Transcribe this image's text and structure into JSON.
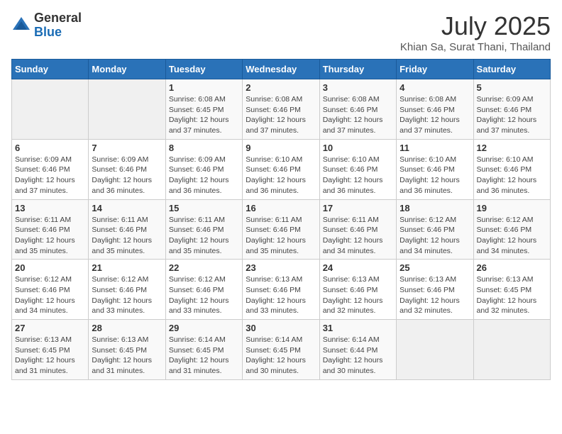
{
  "header": {
    "logo": {
      "general": "General",
      "blue": "Blue"
    },
    "title": "July 2025",
    "location": "Khian Sa, Surat Thani, Thailand"
  },
  "days_of_week": [
    "Sunday",
    "Monday",
    "Tuesday",
    "Wednesday",
    "Thursday",
    "Friday",
    "Saturday"
  ],
  "weeks": [
    [
      {
        "day": "",
        "empty": true
      },
      {
        "day": "",
        "empty": true
      },
      {
        "day": "1",
        "sunrise": "Sunrise: 6:08 AM",
        "sunset": "Sunset: 6:45 PM",
        "daylight": "Daylight: 12 hours and 37 minutes."
      },
      {
        "day": "2",
        "sunrise": "Sunrise: 6:08 AM",
        "sunset": "Sunset: 6:46 PM",
        "daylight": "Daylight: 12 hours and 37 minutes."
      },
      {
        "day": "3",
        "sunrise": "Sunrise: 6:08 AM",
        "sunset": "Sunset: 6:46 PM",
        "daylight": "Daylight: 12 hours and 37 minutes."
      },
      {
        "day": "4",
        "sunrise": "Sunrise: 6:08 AM",
        "sunset": "Sunset: 6:46 PM",
        "daylight": "Daylight: 12 hours and 37 minutes."
      },
      {
        "day": "5",
        "sunrise": "Sunrise: 6:09 AM",
        "sunset": "Sunset: 6:46 PM",
        "daylight": "Daylight: 12 hours and 37 minutes."
      }
    ],
    [
      {
        "day": "6",
        "sunrise": "Sunrise: 6:09 AM",
        "sunset": "Sunset: 6:46 PM",
        "daylight": "Daylight: 12 hours and 37 minutes."
      },
      {
        "day": "7",
        "sunrise": "Sunrise: 6:09 AM",
        "sunset": "Sunset: 6:46 PM",
        "daylight": "Daylight: 12 hours and 36 minutes."
      },
      {
        "day": "8",
        "sunrise": "Sunrise: 6:09 AM",
        "sunset": "Sunset: 6:46 PM",
        "daylight": "Daylight: 12 hours and 36 minutes."
      },
      {
        "day": "9",
        "sunrise": "Sunrise: 6:10 AM",
        "sunset": "Sunset: 6:46 PM",
        "daylight": "Daylight: 12 hours and 36 minutes."
      },
      {
        "day": "10",
        "sunrise": "Sunrise: 6:10 AM",
        "sunset": "Sunset: 6:46 PM",
        "daylight": "Daylight: 12 hours and 36 minutes."
      },
      {
        "day": "11",
        "sunrise": "Sunrise: 6:10 AM",
        "sunset": "Sunset: 6:46 PM",
        "daylight": "Daylight: 12 hours and 36 minutes."
      },
      {
        "day": "12",
        "sunrise": "Sunrise: 6:10 AM",
        "sunset": "Sunset: 6:46 PM",
        "daylight": "Daylight: 12 hours and 36 minutes."
      }
    ],
    [
      {
        "day": "13",
        "sunrise": "Sunrise: 6:11 AM",
        "sunset": "Sunset: 6:46 PM",
        "daylight": "Daylight: 12 hours and 35 minutes."
      },
      {
        "day": "14",
        "sunrise": "Sunrise: 6:11 AM",
        "sunset": "Sunset: 6:46 PM",
        "daylight": "Daylight: 12 hours and 35 minutes."
      },
      {
        "day": "15",
        "sunrise": "Sunrise: 6:11 AM",
        "sunset": "Sunset: 6:46 PM",
        "daylight": "Daylight: 12 hours and 35 minutes."
      },
      {
        "day": "16",
        "sunrise": "Sunrise: 6:11 AM",
        "sunset": "Sunset: 6:46 PM",
        "daylight": "Daylight: 12 hours and 35 minutes."
      },
      {
        "day": "17",
        "sunrise": "Sunrise: 6:11 AM",
        "sunset": "Sunset: 6:46 PM",
        "daylight": "Daylight: 12 hours and 34 minutes."
      },
      {
        "day": "18",
        "sunrise": "Sunrise: 6:12 AM",
        "sunset": "Sunset: 6:46 PM",
        "daylight": "Daylight: 12 hours and 34 minutes."
      },
      {
        "day": "19",
        "sunrise": "Sunrise: 6:12 AM",
        "sunset": "Sunset: 6:46 PM",
        "daylight": "Daylight: 12 hours and 34 minutes."
      }
    ],
    [
      {
        "day": "20",
        "sunrise": "Sunrise: 6:12 AM",
        "sunset": "Sunset: 6:46 PM",
        "daylight": "Daylight: 12 hours and 34 minutes."
      },
      {
        "day": "21",
        "sunrise": "Sunrise: 6:12 AM",
        "sunset": "Sunset: 6:46 PM",
        "daylight": "Daylight: 12 hours and 33 minutes."
      },
      {
        "day": "22",
        "sunrise": "Sunrise: 6:12 AM",
        "sunset": "Sunset: 6:46 PM",
        "daylight": "Daylight: 12 hours and 33 minutes."
      },
      {
        "day": "23",
        "sunrise": "Sunrise: 6:13 AM",
        "sunset": "Sunset: 6:46 PM",
        "daylight": "Daylight: 12 hours and 33 minutes."
      },
      {
        "day": "24",
        "sunrise": "Sunrise: 6:13 AM",
        "sunset": "Sunset: 6:46 PM",
        "daylight": "Daylight: 12 hours and 32 minutes."
      },
      {
        "day": "25",
        "sunrise": "Sunrise: 6:13 AM",
        "sunset": "Sunset: 6:46 PM",
        "daylight": "Daylight: 12 hours and 32 minutes."
      },
      {
        "day": "26",
        "sunrise": "Sunrise: 6:13 AM",
        "sunset": "Sunset: 6:45 PM",
        "daylight": "Daylight: 12 hours and 32 minutes."
      }
    ],
    [
      {
        "day": "27",
        "sunrise": "Sunrise: 6:13 AM",
        "sunset": "Sunset: 6:45 PM",
        "daylight": "Daylight: 12 hours and 31 minutes."
      },
      {
        "day": "28",
        "sunrise": "Sunrise: 6:13 AM",
        "sunset": "Sunset: 6:45 PM",
        "daylight": "Daylight: 12 hours and 31 minutes."
      },
      {
        "day": "29",
        "sunrise": "Sunrise: 6:14 AM",
        "sunset": "Sunset: 6:45 PM",
        "daylight": "Daylight: 12 hours and 31 minutes."
      },
      {
        "day": "30",
        "sunrise": "Sunrise: 6:14 AM",
        "sunset": "Sunset: 6:45 PM",
        "daylight": "Daylight: 12 hours and 30 minutes."
      },
      {
        "day": "31",
        "sunrise": "Sunrise: 6:14 AM",
        "sunset": "Sunset: 6:44 PM",
        "daylight": "Daylight: 12 hours and 30 minutes."
      },
      {
        "day": "",
        "empty": true
      },
      {
        "day": "",
        "empty": true
      }
    ]
  ]
}
